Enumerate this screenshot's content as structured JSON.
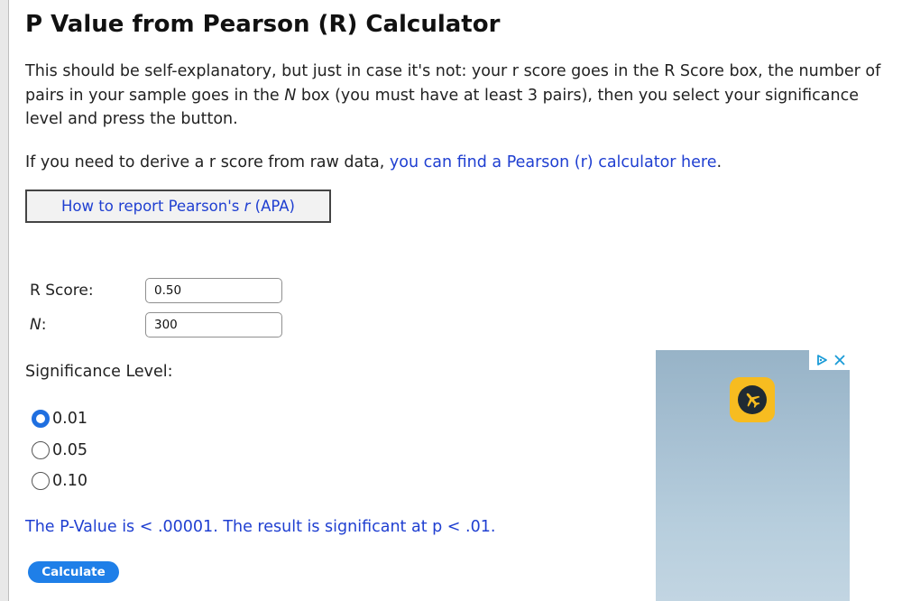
{
  "page": {
    "title": "P Value from Pearson (R) Calculator",
    "intro": {
      "part1": "This should be self-explanatory, but just in case it's not: your r score goes in the R Score box, the number of pairs in your sample goes in the ",
      "n_symbol": "N",
      "part2": " box (you must have at least 3 pairs), then you select your significance level and press the button."
    },
    "raw_data": {
      "text": "If you need to derive a r score from raw data, ",
      "link": "you can find a Pearson (r) calculator here",
      "suffix": "."
    },
    "report_button": {
      "prefix": "How to report Pearson's ",
      "r_symbol": "r",
      "suffix": " (APA)"
    }
  },
  "form": {
    "r_score": {
      "label": "R Score:",
      "value": "0.50"
    },
    "n": {
      "label": "N",
      "label_suffix": ":",
      "value": "300"
    },
    "significance": {
      "label": "Significance Level:",
      "options": [
        "0.01",
        "0.05",
        "0.10"
      ],
      "selected": "0.01"
    },
    "calculate_label": "Calculate"
  },
  "result": {
    "text": "The P-Value is < .00001. The result is significant at p < .01."
  },
  "ad": {
    "icons": [
      "ad-choices-icon",
      "close-icon",
      "airplane-app-icon"
    ],
    "colors": {
      "app_icon": "#f7bc20",
      "choices": "#1a9bd7"
    }
  },
  "colors": {
    "link": "#1f3fd1",
    "button": "#1f7fe8",
    "radio_checked": "#1f6fe0"
  }
}
